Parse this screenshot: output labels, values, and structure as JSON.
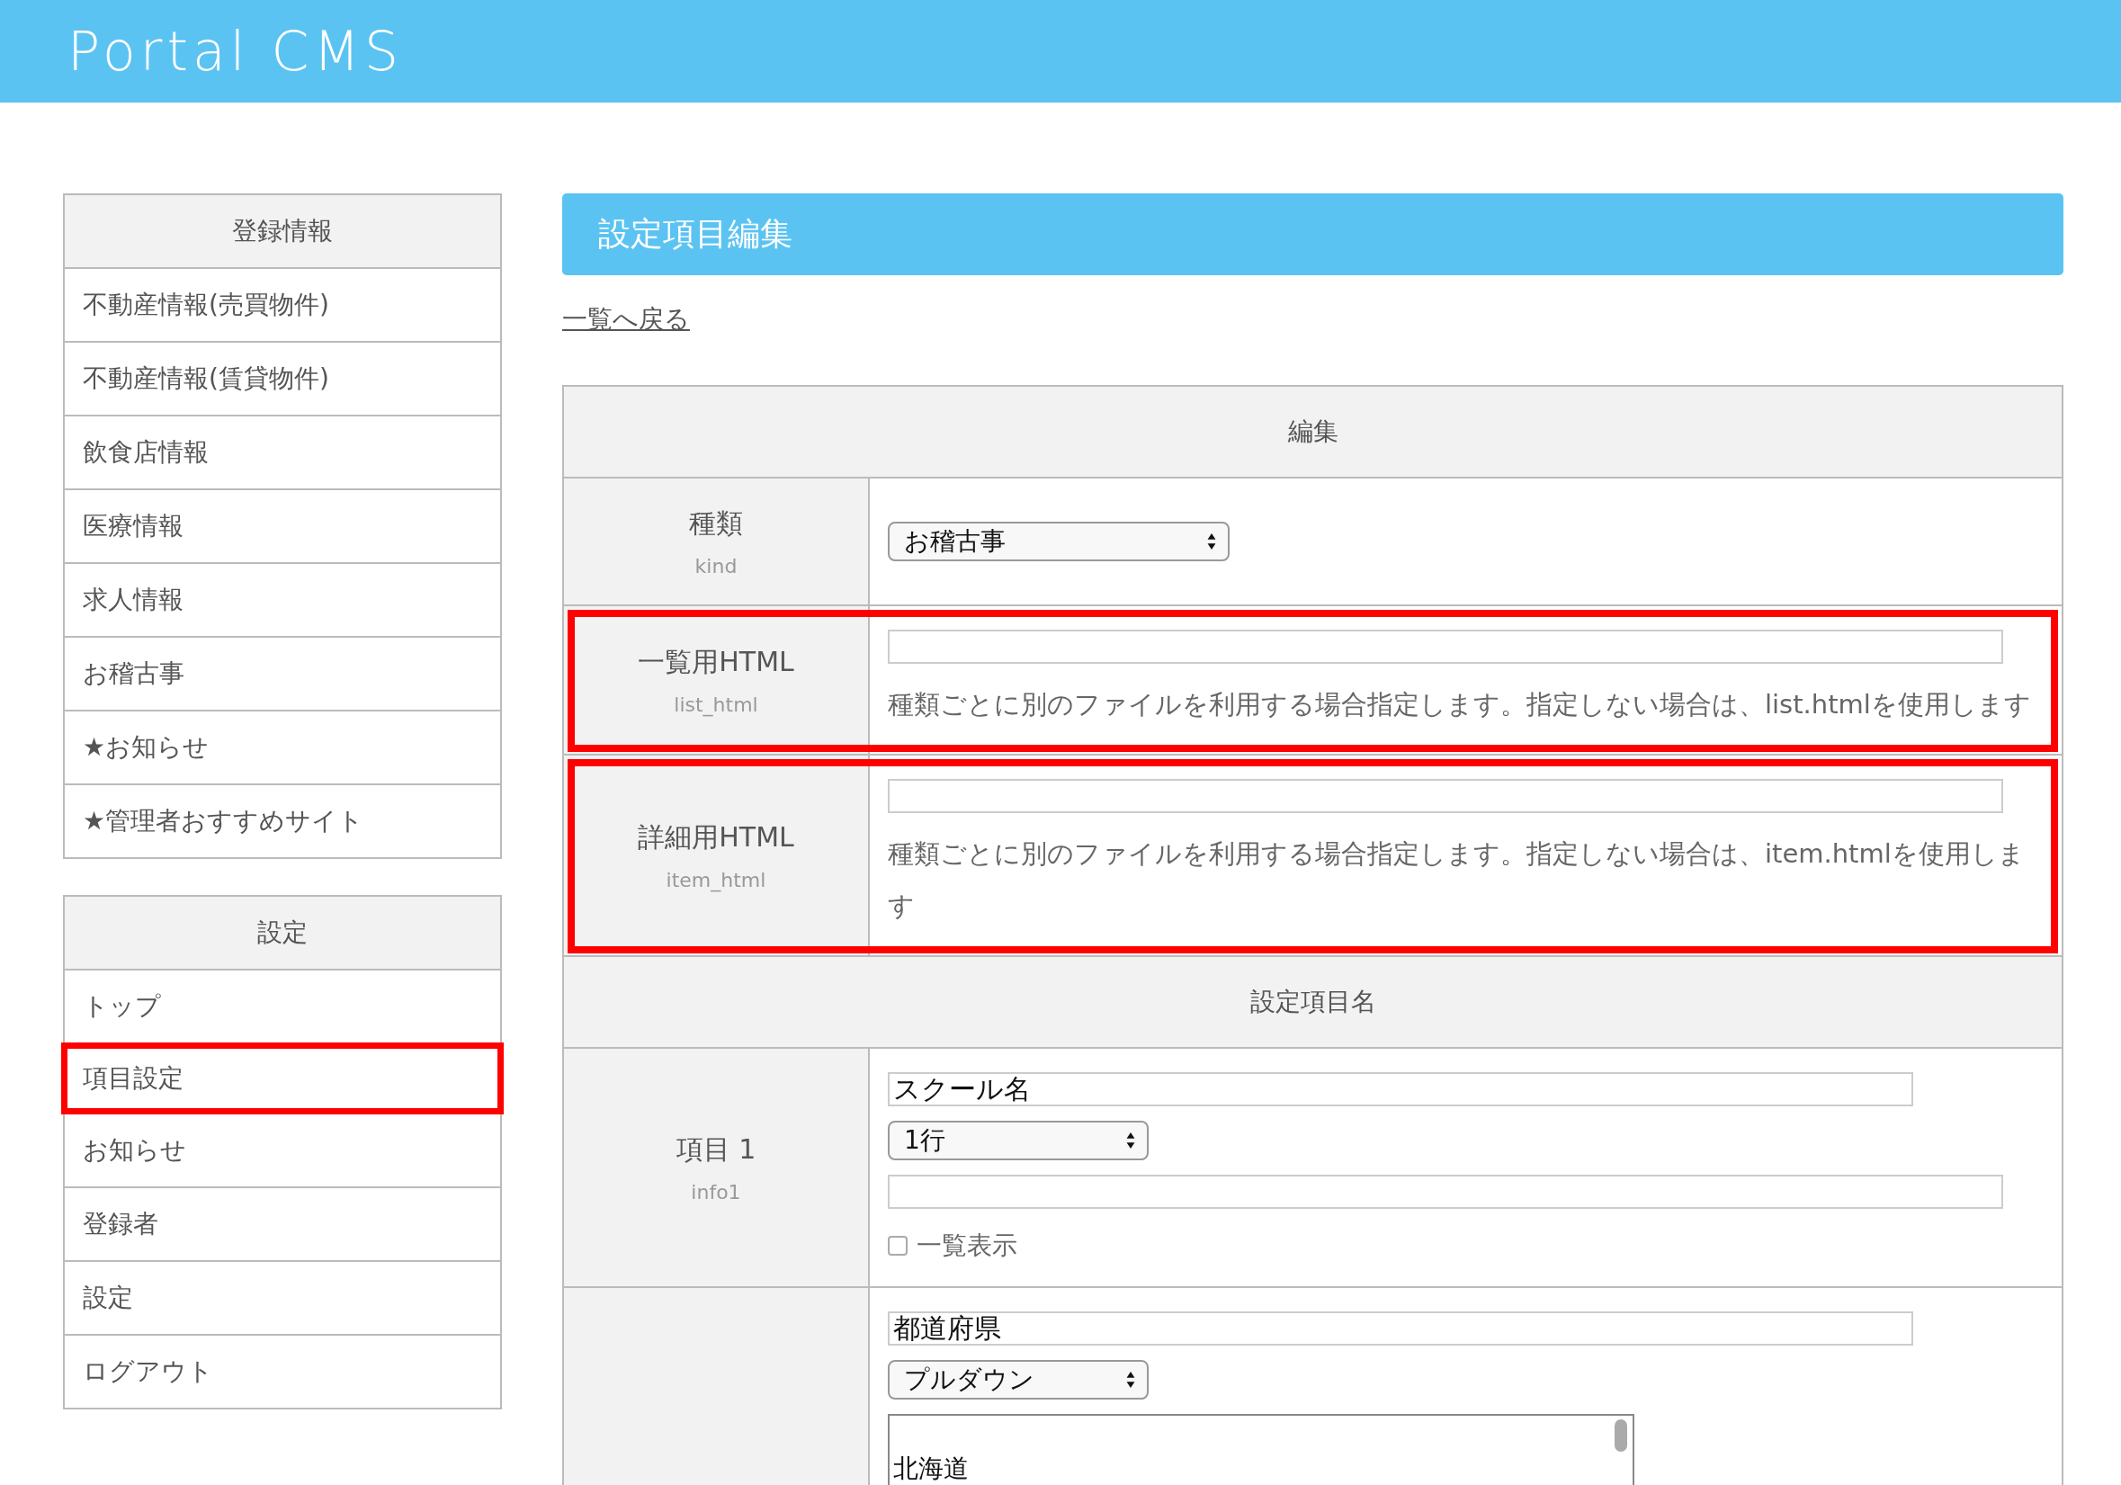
{
  "header": {
    "title": "Portal CMS"
  },
  "sidebar": [
    {
      "title": "登録情報",
      "items": [
        {
          "label": "不動産情報(売買物件)",
          "highlighted": false
        },
        {
          "label": "不動産情報(賃貸物件)",
          "highlighted": false
        },
        {
          "label": "飲食店情報",
          "highlighted": false
        },
        {
          "label": "医療情報",
          "highlighted": false
        },
        {
          "label": "求人情報",
          "highlighted": false
        },
        {
          "label": "お稽古事",
          "highlighted": false
        },
        {
          "label": "★お知らせ",
          "highlighted": false
        },
        {
          "label": "★管理者おすすめサイト",
          "highlighted": false
        }
      ]
    },
    {
      "title": "設定",
      "items": [
        {
          "label": "トップ",
          "highlighted": false
        },
        {
          "label": "項目設定",
          "highlighted": true
        },
        {
          "label": "お知らせ",
          "highlighted": false
        },
        {
          "label": "登録者",
          "highlighted": false
        },
        {
          "label": "設定",
          "highlighted": false
        },
        {
          "label": "ログアウト",
          "highlighted": false
        }
      ]
    }
  ],
  "main": {
    "title": "設定項目編集",
    "back_link": "一覧へ戻る",
    "sections": [
      {
        "heading": "編集",
        "rows": [
          {
            "label": "種類",
            "key": "kind",
            "highlighted": false,
            "fields": [
              {
                "kind": "select",
                "value": "お稽古事"
              }
            ]
          },
          {
            "label": "一覧用HTML",
            "key": "list_html",
            "highlighted": true,
            "fields": [
              {
                "kind": "text"
              },
              {
                "kind": "help",
                "text": "種類ごとに別のファイルを利用する場合指定します。指定しない場合は、list.htmlを使用します"
              }
            ]
          },
          {
            "label": "詳細用HTML",
            "key": "item_html",
            "highlighted": true,
            "fields": [
              {
                "kind": "text"
              },
              {
                "kind": "help",
                "text": "種類ごとに別のファイルを利用する場合指定します。指定しない場合は、item.htmlを使用します"
              }
            ]
          }
        ]
      },
      {
        "heading": "設定項目名",
        "rows": [
          {
            "label": "項目 1",
            "key": "info1",
            "highlighted": false,
            "fields": [
              {
                "kind": "short_text",
                "value": "スクール名"
              },
              {
                "kind": "select",
                "value": "1行"
              },
              {
                "kind": "text"
              },
              {
                "kind": "checkbox",
                "label": "一覧表示",
                "checked": false
              }
            ]
          },
          {
            "highlighted": false,
            "fields": [
              {
                "kind": "short_text",
                "value": "都道府県"
              },
              {
                "kind": "select",
                "value": "プルダウン"
              },
              {
                "kind": "textarea",
                "value": "北海道"
              }
            ]
          }
        ]
      }
    ]
  }
}
